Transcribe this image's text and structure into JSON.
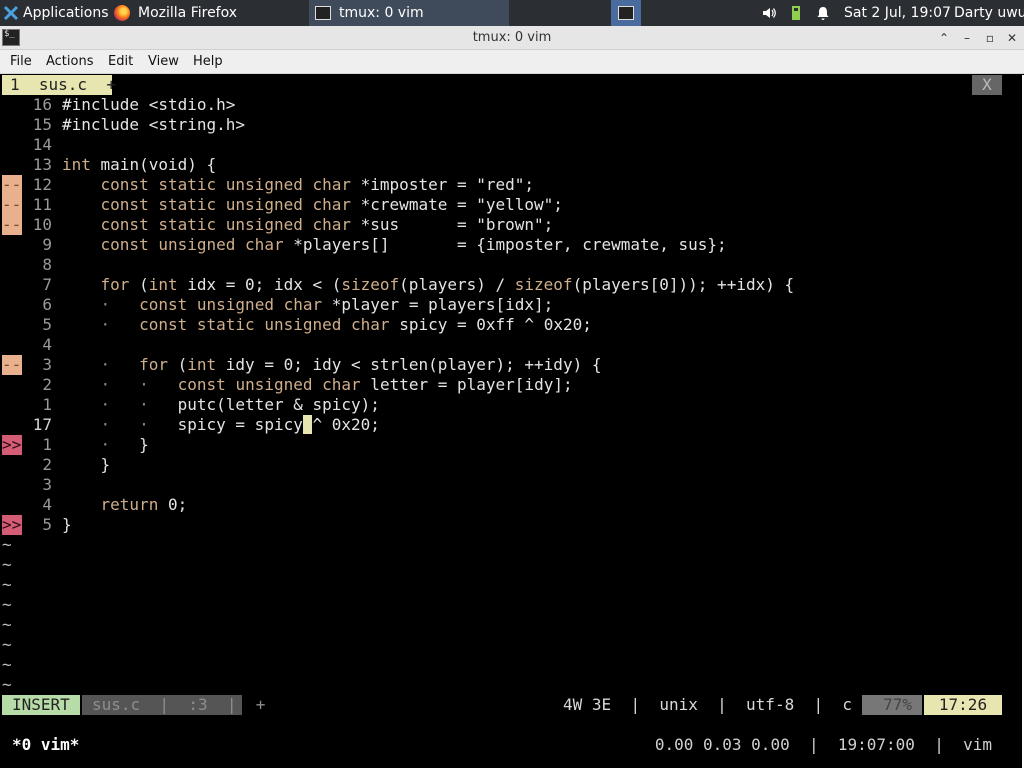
{
  "panel": {
    "applications_label": "Applications",
    "firefox_task": "Mozilla Firefox",
    "tmux_task": "tmux: 0 vim",
    "clock": "Sat  2 Jul, 19:07",
    "user": "Darty uwu"
  },
  "window": {
    "title": "tmux: 0 vim"
  },
  "menu": {
    "file": "File",
    "actions": "Actions",
    "edit": "Edit",
    "view": "View",
    "help": "Help"
  },
  "vim": {
    "tab_label": "1  sus.c  +",
    "tab_close": "X",
    "lines": [
      {
        "sign": "",
        "num": "16",
        "text": "#include <stdio.h>"
      },
      {
        "sign": "",
        "num": "15",
        "text": "#include <string.h>"
      },
      {
        "sign": "",
        "num": "14",
        "text": ""
      },
      {
        "sign": "",
        "num": "13",
        "text": "int main(void) {"
      },
      {
        "sign": "--",
        "num": "12",
        "text": "    const static unsigned char *imposter = \"red\";"
      },
      {
        "sign": "--",
        "num": "11",
        "text": "    const static unsigned char *crewmate = \"yellow\";"
      },
      {
        "sign": "--",
        "num": "10",
        "text": "    const static unsigned char *sus      = \"brown\";"
      },
      {
        "sign": "",
        "num": "9",
        "text": "    const unsigned char *players[]       = {imposter, crewmate, sus};"
      },
      {
        "sign": "",
        "num": "8",
        "text": ""
      },
      {
        "sign": "",
        "num": "7",
        "text": "    for (int idx = 0; idx < (sizeof(players) / sizeof(players[0])); ++idx) {"
      },
      {
        "sign": "",
        "num": "6",
        "text": "    ·   const unsigned char *player = players[idx];"
      },
      {
        "sign": "",
        "num": "5",
        "text": "    ·   const static unsigned char spicy = 0xff ^ 0x20;"
      },
      {
        "sign": "",
        "num": "4",
        "text": ""
      },
      {
        "sign": "--",
        "num": "3",
        "text": "    ·   for (int idy = 0; idy < strlen(player); ++idy) {"
      },
      {
        "sign": "",
        "num": "2",
        "text": "    ·   ·   const unsigned char letter = player[idy];"
      },
      {
        "sign": "",
        "num": "1",
        "text": "    ·   ·   putc(letter & spicy);"
      },
      {
        "sign": "",
        "num": "17",
        "text": "    ·   ·   spicy = spicy ^ 0x20;"
      },
      {
        "sign": ">>",
        "num": "1",
        "text": "    ·   }"
      },
      {
        "sign": "",
        "num": "2",
        "text": "    }"
      },
      {
        "sign": "",
        "num": "3",
        "text": ""
      },
      {
        "sign": "",
        "num": "4",
        "text": "    return 0;"
      },
      {
        "sign": ">>",
        "num": "5",
        "text": "}"
      }
    ],
    "tildes": [
      "~",
      "~",
      "~",
      "~",
      "~",
      "~",
      "~",
      "~"
    ],
    "status": {
      "mode": "INSERT",
      "file": "sus.c  |  :3  |  +",
      "info": "4W 3E  |  unix  |  utf-8  |  c",
      "percent": "77%",
      "position": "17:26"
    }
  },
  "tmux": {
    "window": "*0 vim*",
    "right": "0.00 0.03 0.00  |  19:07:00  |  vim"
  }
}
